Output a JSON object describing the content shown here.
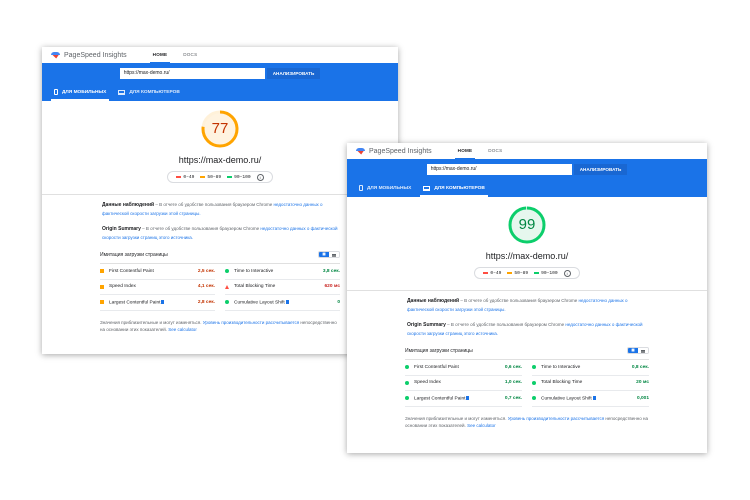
{
  "mobile": {
    "brand": "PageSpeed Insights",
    "nav": [
      "HOME",
      "DOCS"
    ],
    "url_value": "https://max-demo.ru/",
    "analyze_label": "АНАЛИЗИРОВАТЬ",
    "tab_mobile": "ДЛЯ МОБИЛЬНЫХ",
    "tab_desktop": "ДЛЯ КОМПЬЮТЕРОВ",
    "active_tab": "mobile",
    "score": "77",
    "score_value": 77,
    "score_color": "#ffa400",
    "score_text_color": "#c33300",
    "site": "https://max-demo.ru/",
    "legend": [
      "0–49",
      "50–89",
      "90–100"
    ],
    "field_title": "Данные наблюдений",
    "field_desc_a": "– В отчете об удобстве пользования браузером Chrome ",
    "field_desc_link": "недостаточно данных о фактической скорости загрузки этой страницы.",
    "origin_title": "Origin Summary",
    "origin_desc_a": "– В отчете об удобстве пользования браузером Chrome ",
    "origin_desc_link": "недостаточно данных о фактической скорости загрузки страниц этого источника.",
    "sim_title": "Имитация загрузки страницы",
    "metrics": [
      {
        "name": "First Contentful Paint",
        "value": "2,5 сек.",
        "status": "orange"
      },
      {
        "name": "Time to Interactive",
        "value": "3,8 сек.",
        "status": "green"
      },
      {
        "name": "Speed Index",
        "value": "4,1 сек.",
        "status": "orange"
      },
      {
        "name": "Total Blocking Time",
        "value": "620 мс",
        "status": "red"
      },
      {
        "name": "Largest Contentful Paint",
        "value": "2,8 сек.",
        "status": "orange"
      },
      {
        "name": "Cumulative Layout Shift",
        "value": "0",
        "status": "green"
      }
    ],
    "foot_a": "Значения приблизительные и могут изменяться. ",
    "foot_link": "Уровень производительности рассчитывается",
    "foot_b": " непосредственно на основании этих показателей. ",
    "foot_link2": "See calculator"
  },
  "desktop": {
    "brand": "PageSpeed Insights",
    "nav": [
      "HOME",
      "DOCS"
    ],
    "url_value": "https://max-demo.ru/",
    "analyze_label": "АНАЛИЗИРОВАТЬ",
    "tab_mobile": "ДЛЯ МОБИЛЬНЫХ",
    "tab_desktop": "ДЛЯ КОМПЬЮТЕРОВ",
    "active_tab": "desktop",
    "score": "99",
    "score_value": 99,
    "score_color": "#0cce6b",
    "score_text_color": "#018642",
    "site": "https://max-demo.ru/",
    "legend": [
      "0–49",
      "50–89",
      "90–100"
    ],
    "field_title": "Данные наблюдений",
    "field_desc_a": "– В отчете об удобстве пользования браузером Chrome ",
    "field_desc_link": "недостаточно данных о фактической скорости загрузки этой страницы.",
    "origin_title": "Origin Summary",
    "origin_desc_a": "– В отчете об удобстве пользования браузером Chrome ",
    "origin_desc_link": "недостаточно данных о фактической скорости загрузки страниц этого источника.",
    "sim_title": "Имитация загрузки страницы",
    "metrics": [
      {
        "name": "First Contentful Paint",
        "value": "0,6 сек.",
        "status": "green"
      },
      {
        "name": "Time to Interactive",
        "value": "0,8 сек.",
        "status": "green"
      },
      {
        "name": "Speed Index",
        "value": "1,0 сек.",
        "status": "green"
      },
      {
        "name": "Total Blocking Time",
        "value": "20 мс",
        "status": "green"
      },
      {
        "name": "Largest Contentful Paint",
        "value": "0,7 сек.",
        "status": "green"
      },
      {
        "name": "Cumulative Layout Shift",
        "value": "0,001",
        "status": "green"
      }
    ],
    "foot_a": "Значения приблизительные и могут изменяться. ",
    "foot_link": "Уровень производительности рассчитывается",
    "foot_b": " непосредственно на основании этих показателей. ",
    "foot_link2": "See calculator"
  },
  "legend_colors": [
    "#ff4e42",
    "#ffa400",
    "#0cce6b"
  ]
}
